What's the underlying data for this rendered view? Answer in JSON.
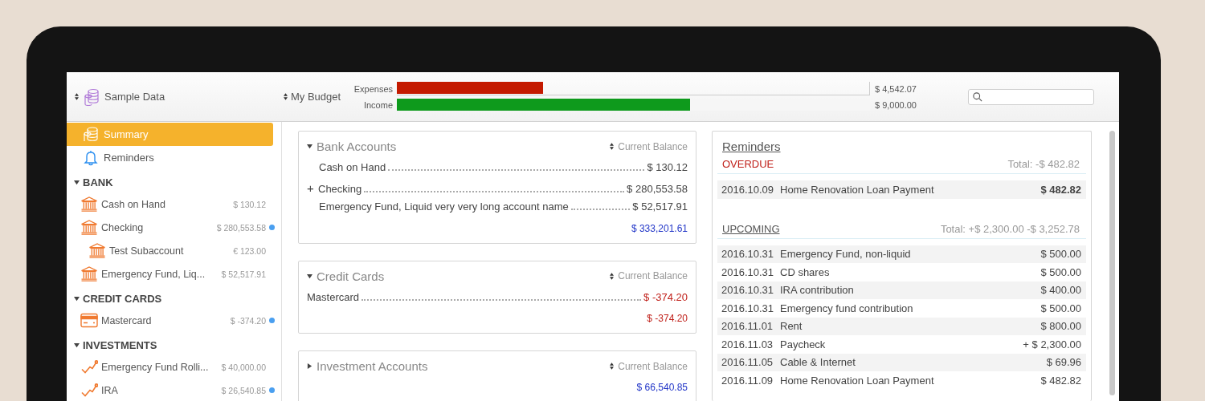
{
  "toolbar": {
    "library": "Sample Data",
    "budget": "My Budget",
    "budget_bars": [
      {
        "label": "Expenses",
        "kind": "expense",
        "level": 0.31,
        "amount": "$ 4,542.07"
      },
      {
        "label": "Income",
        "kind": "income",
        "level": 0.62,
        "amount": "$ 9,000.00"
      }
    ]
  },
  "sidebar": {
    "items": [
      {
        "label": "Summary",
        "kind": "summary",
        "selected": true
      },
      {
        "label": "Reminders",
        "kind": "reminders",
        "selected": false
      }
    ],
    "groups": [
      {
        "title": "BANK",
        "expanded": true,
        "accounts": [
          {
            "name": "Cash on Hand",
            "kind": "bank",
            "amount": "$ 130.12",
            "marked": false
          },
          {
            "name": "Checking",
            "kind": "bank",
            "amount": "$ 280,553.58",
            "marked": true,
            "children": [
              {
                "name": "Test Subaccount",
                "kind": "bank",
                "amount": "€ 123.00",
                "marked": false
              }
            ]
          },
          {
            "name": "Emergency Fund, Liq...",
            "kind": "bank",
            "amount": "$ 52,517.91",
            "marked": false
          }
        ]
      },
      {
        "title": "CREDIT CARDS",
        "expanded": true,
        "accounts": [
          {
            "name": "Mastercard",
            "kind": "card",
            "amount": "$ -374.20",
            "marked": true
          }
        ]
      },
      {
        "title": "INVESTMENTS",
        "expanded": true,
        "accounts": [
          {
            "name": "Emergency Fund Rolli...",
            "kind": "investment",
            "amount": "$ 40,000.00",
            "marked": false
          },
          {
            "name": "IRA",
            "kind": "investment",
            "amount": "$ 26,540.85",
            "marked": true
          }
        ]
      }
    ]
  },
  "summary_cards": [
    {
      "title": "Bank Accounts",
      "expanded": true,
      "sort_label": "Current Balance",
      "rows": [
        {
          "name": "Cash on Hand",
          "amount": "$ 130.12",
          "negative": false,
          "indented": true
        },
        {
          "prefix": "+",
          "name": "Checking",
          "amount": "$ 280,553.58",
          "negative": false,
          "indented": false
        },
        {
          "name": "Emergency Fund, Liquid very very long account name",
          "amount": "$ 52,517.91",
          "negative": false,
          "indented": true
        }
      ],
      "total": "$ 333,201.61",
      "negative": false
    },
    {
      "title": "Credit Cards",
      "expanded": true,
      "sort_label": "Current Balance",
      "rows": [
        {
          "name": "Mastercard",
          "amount": "$ -374.20",
          "negative": true,
          "indented": false
        }
      ],
      "total": "$ -374.20",
      "negative": true
    },
    {
      "title": "Investment Accounts",
      "expanded": false,
      "sort_label": "Current Balance",
      "total": "$ 66,540.85",
      "negative": false
    }
  ],
  "reminders": {
    "title": "Reminders",
    "sections": [
      {
        "title": "OVERDUE",
        "kind": "overdue",
        "total": "Total:  -$ 482.82",
        "rows": [
          {
            "date": "2016.10.09",
            "name": "Home Renovation Loan Payment",
            "amount": "$ 482.82"
          }
        ]
      },
      {
        "title": "UPCOMING",
        "kind": "upcoming",
        "total": "Total:  +$ 2,300.00 -$ 3,252.78",
        "rows": [
          {
            "date": "2016.10.31",
            "name": "Emergency Fund, non-liquid",
            "amount": "$ 500.00"
          },
          {
            "date": "2016.10.31",
            "name": "CD shares",
            "amount": "$ 500.00"
          },
          {
            "date": "2016.10.31",
            "name": "IRA contribution",
            "amount": "$ 400.00"
          },
          {
            "date": "2016.10.31",
            "name": "Emergency fund contribution",
            "amount": "$ 500.00"
          },
          {
            "date": "2016.11.01",
            "name": "Rent",
            "amount": "$ 800.00"
          },
          {
            "date": "2016.11.03",
            "name": "Paycheck",
            "amount": "+ $ 2,300.00"
          },
          {
            "date": "2016.11.05",
            "name": "Cable & Internet",
            "amount": "$ 69.96"
          },
          {
            "date": "2016.11.09",
            "name": "Home Renovation Loan Payment",
            "amount": "$ 482.82"
          }
        ]
      }
    ]
  }
}
